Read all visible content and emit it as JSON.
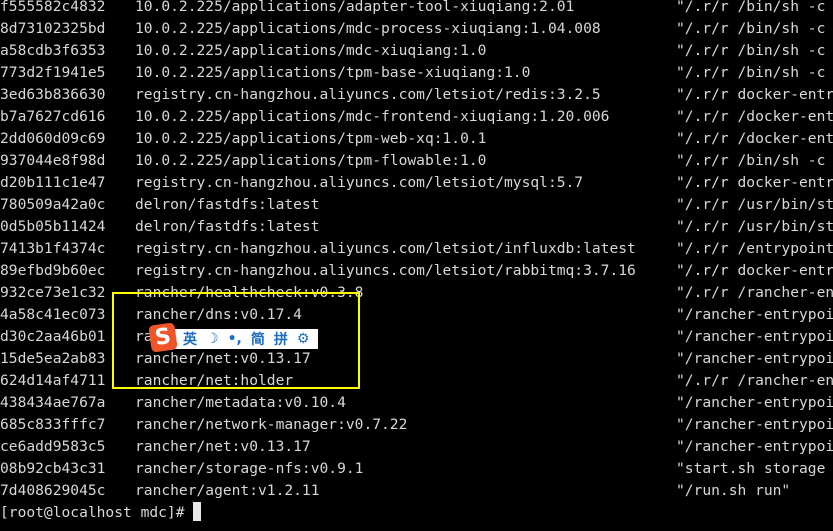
{
  "rows": [
    {
      "id": "f555582c4832",
      "image": "10.0.2.225/applications/adapter-tool-xiuqiang:2.01",
      "command": "\"/.r/r /bin/sh -c"
    },
    {
      "id": "8d73102325bd",
      "image": "10.0.2.225/applications/mdc-process-xiuqiang:1.04.008",
      "command": "\"/.r/r /bin/sh -c"
    },
    {
      "id": "a58cdb3f6353",
      "image": "10.0.2.225/applications/mdc-xiuqiang:1.0",
      "command": "\"/.r/r /bin/sh -c"
    },
    {
      "id": "773d2f1941e5",
      "image": "10.0.2.225/applications/tpm-base-xiuqiang:1.0",
      "command": "\"/.r/r /bin/sh -c"
    },
    {
      "id": "3ed63b836630",
      "image": "registry.cn-hangzhou.aliyuncs.com/letsiot/redis:3.2.5",
      "command": "\"/.r/r docker-entr"
    },
    {
      "id": "b7a7627cd616",
      "image": "10.0.2.225/applications/mdc-frontend-xiuqiang:1.20.006",
      "command": "\"/.r/r /docker-ent"
    },
    {
      "id": "2dd060d09c69",
      "image": "10.0.2.225/applications/tpm-web-xq:1.0.1",
      "command": "\"/.r/r /docker-ent"
    },
    {
      "id": "937044e8f98d",
      "image": "10.0.2.225/applications/tpm-flowable:1.0",
      "command": "\"/.r/r /bin/sh -c"
    },
    {
      "id": "d20b111c1e47",
      "image": "registry.cn-hangzhou.aliyuncs.com/letsiot/mysql:5.7",
      "command": "\"/.r/r docker-entr"
    },
    {
      "id": "780509a42a0c",
      "image": "delron/fastdfs:latest",
      "command": "\"/.r/r /usr/bin/st"
    },
    {
      "id": "0d5b05b11424",
      "image": "delron/fastdfs:latest",
      "command": "\"/.r/r /usr/bin/st"
    },
    {
      "id": "7413b1f4374c",
      "image": "registry.cn-hangzhou.aliyuncs.com/letsiot/influxdb:latest",
      "command": "\"/.r/r /entrypoint"
    },
    {
      "id": "89efbd9b60ec",
      "image": "registry.cn-hangzhou.aliyuncs.com/letsiot/rabbitmq:3.7.16",
      "command": "\"/.r/r docker-entr"
    },
    {
      "id": "932ce73e1c32",
      "image": "rancher/healthcheck:v0.3.8",
      "command": "\"/.r/r /rancher-en"
    },
    {
      "id": "4a58c41ec073",
      "image": "rancher/dns:v0.17.4",
      "command": "\"/rancher-entrypoi"
    },
    {
      "id": "d30c2aa46b01",
      "image": "ra",
      "command": "\"/rancher-entrypoi"
    },
    {
      "id": "15de5ea2ab83",
      "image": "rancher/net:v0.13.17",
      "command": "\"/rancher-entrypoi"
    },
    {
      "id": "624d14af4711",
      "image": "rancher/net:holder",
      "command": "\"/.r/r /rancher-en"
    },
    {
      "id": "438434ae767a",
      "image": "rancher/metadata:v0.10.4",
      "command": "\"/rancher-entrypoi"
    },
    {
      "id": "685c833fffc7",
      "image": "rancher/network-manager:v0.7.22",
      "command": "\"/rancher-entrypoi"
    },
    {
      "id": "ce6add9583c5",
      "image": "rancher/net:v0.13.17",
      "command": "\"/rancher-entrypoi"
    },
    {
      "id": "08b92cb43c31",
      "image": "rancher/storage-nfs:v0.9.1",
      "command": "\"start.sh storage"
    },
    {
      "id": "7d408629045c",
      "image": "rancher/agent:v1.2.11",
      "command": "\"/run.sh run\""
    }
  ],
  "prompt": "[root@localhost mdc]#",
  "ime": {
    "logo": "S",
    "lang": "英",
    "moon": "☽",
    "punct": "•,",
    "simplified": "简",
    "pinyin": "拼",
    "gear": "⚙"
  },
  "colors": {
    "background": "#000000",
    "text": "#d8d8d8",
    "highlight": "#ffff00",
    "ime_blue": "#1b6cc6",
    "ime_logo": "#f0552a"
  }
}
